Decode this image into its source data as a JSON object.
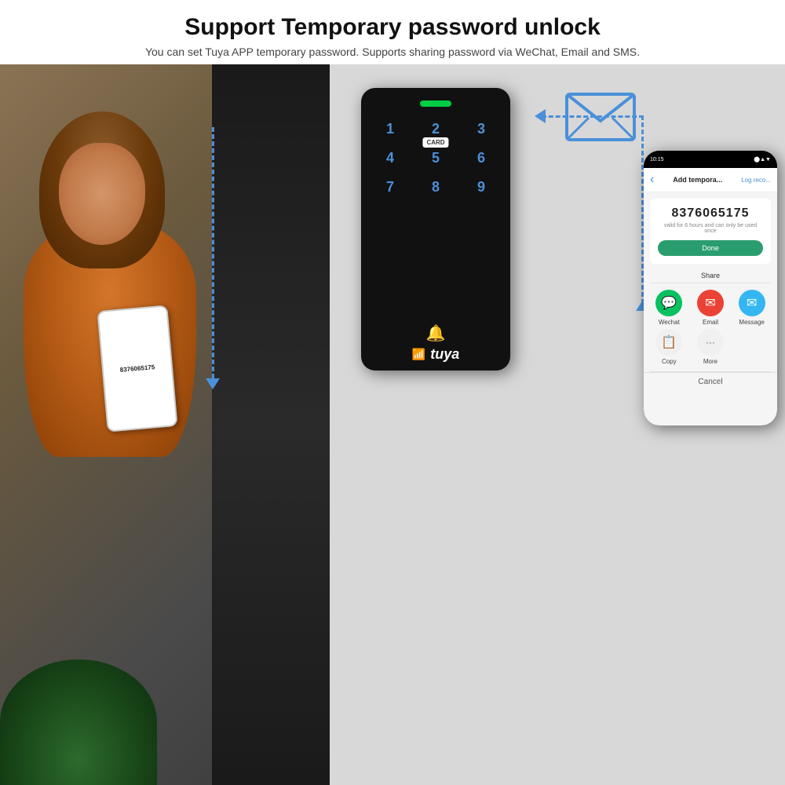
{
  "header": {
    "title": "Support Temporary password unlock",
    "subtitle": "You can set Tuya APP temporary password. Supports sharing password via WeChat, Email and SMS."
  },
  "left_panel": {
    "phone_number": "8376065175",
    "dashed_line": true
  },
  "right_panel": {
    "keypad": {
      "keys": [
        "1",
        "2",
        "3",
        "4",
        "5",
        "6",
        "7",
        "8",
        "9"
      ],
      "card_label": "CARD",
      "brand": "tuya"
    },
    "email_icon": "✉",
    "smartphone": {
      "status_bar": {
        "time": "10:15",
        "icons": "⬛ ◀ ▲ ▼ ◼"
      },
      "header": {
        "back": "‹",
        "title": "Add tempora...",
        "log": "Log reco..."
      },
      "password": {
        "number": "8376065175",
        "subtitle": "valid for 6 hours and can only be used once"
      },
      "done_button": "Done",
      "share_label": "Share",
      "share_options": [
        {
          "label": "Wechat",
          "icon": "💬",
          "type": "wechat"
        },
        {
          "label": "Email",
          "icon": "✉",
          "type": "email"
        },
        {
          "label": "Message",
          "icon": "✉",
          "type": "message"
        },
        {
          "label": "Copy",
          "icon": "📋",
          "type": "copy"
        },
        {
          "label": "More",
          "icon": "···",
          "type": "more"
        }
      ],
      "cancel_label": "Cancel"
    }
  },
  "colors": {
    "accent_blue": "#4a90d9",
    "brand_green": "#2a9d6e",
    "background_right": "#d8d8d8",
    "keypad_bg": "#111111"
  }
}
